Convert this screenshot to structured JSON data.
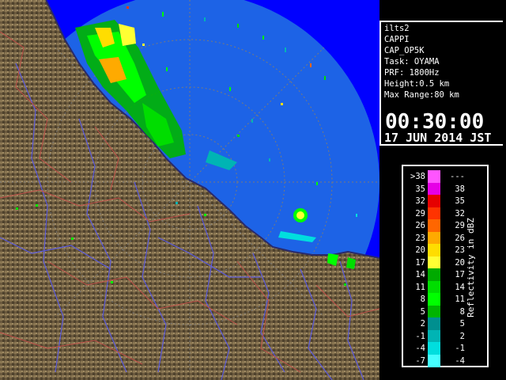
{
  "info": {
    "lines": [
      "ilts2",
      "CAPPI",
      "CAP_OP5K",
      "Task: OYAMA",
      "PRF: 1800Hz",
      "Height:0.5 km",
      "Max Range:80 km"
    ],
    "time": "00:30:00",
    "date": "17 JUN 2014 JST"
  },
  "legend": {
    "title": "Reflectivity in dBZ",
    "rows": [
      {
        "lo": ">38",
        "hi": "---",
        "color": "#ff55ff"
      },
      {
        "lo": "35",
        "hi": "38",
        "color": "#e600e6"
      },
      {
        "lo": "32",
        "hi": "35",
        "color": "#e60000"
      },
      {
        "lo": "29",
        "hi": "32",
        "color": "#ff3300"
      },
      {
        "lo": "26",
        "hi": "29",
        "color": "#ff6600"
      },
      {
        "lo": "23",
        "hi": "26",
        "color": "#ffaa00"
      },
      {
        "lo": "20",
        "hi": "23",
        "color": "#ffdd00"
      },
      {
        "lo": "17",
        "hi": "20",
        "color": "#ffff33"
      },
      {
        "lo": "14",
        "hi": "17",
        "color": "#00aa00"
      },
      {
        "lo": "11",
        "hi": "14",
        "color": "#00dd00"
      },
      {
        "lo": "8",
        "hi": "11",
        "color": "#00ff00"
      },
      {
        "lo": "5",
        "hi": "8",
        "color": "#00b400"
      },
      {
        "lo": "2",
        "hi": "5",
        "color": "#008f8f"
      },
      {
        "lo": "-1",
        "hi": "2",
        "color": "#00b4b4"
      },
      {
        "lo": "-4",
        "hi": "-1",
        "color": "#00dede"
      },
      {
        "lo": "-7",
        "hi": "-4",
        "color": "#44ffff"
      }
    ]
  },
  "colors": {
    "radar_disc": "#1d63e6",
    "outside_disc": "#0000ff",
    "terrain": "#6b5a3e",
    "rivers": "#5a5adc",
    "boundaries": "#c0504a"
  }
}
